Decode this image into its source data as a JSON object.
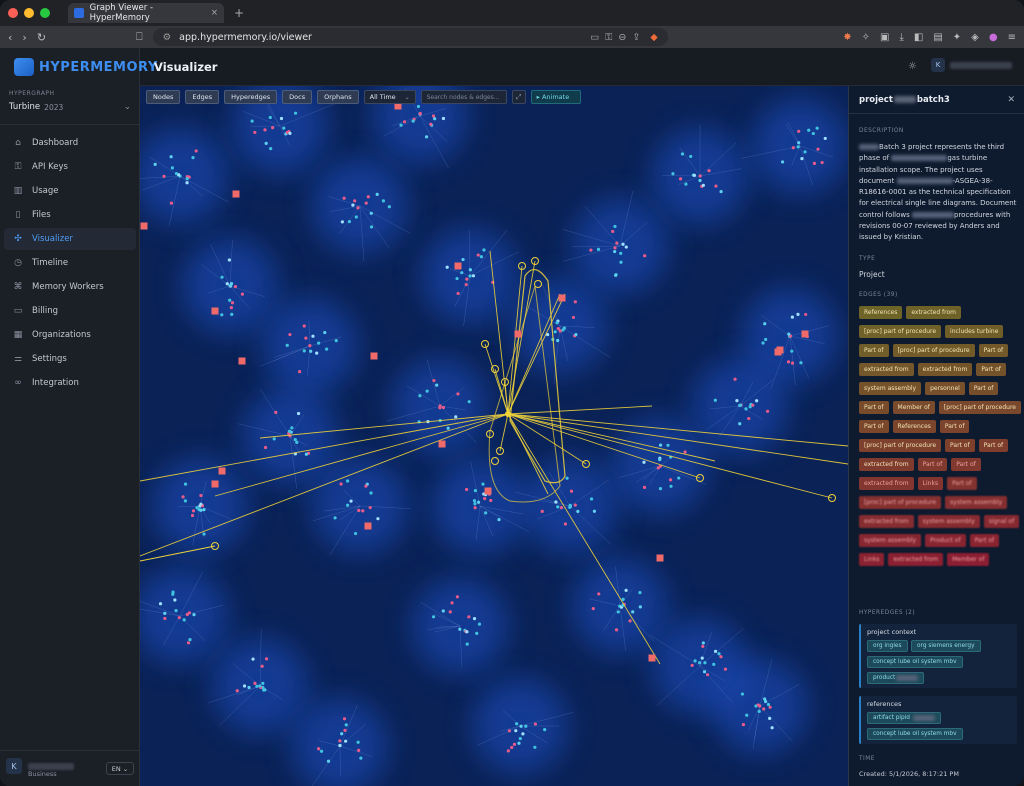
{
  "browser": {
    "tab_title": "Graph Viewer - HyperMemory",
    "url": "app.hypermemory.io/viewer"
  },
  "sidebar": {
    "logo": "HYPERMEMORY",
    "hypergraph_label": "HYPERGRAPH",
    "hypergraph_name": "Turbine",
    "hypergraph_year": "2023",
    "items": [
      {
        "label": "Dashboard",
        "icon": "home-icon"
      },
      {
        "label": "API Keys",
        "icon": "key-icon"
      },
      {
        "label": "Usage",
        "icon": "chart-icon"
      },
      {
        "label": "Files",
        "icon": "file-icon"
      },
      {
        "label": "Visualizer",
        "icon": "graph-icon",
        "active": true
      },
      {
        "label": "Timeline",
        "icon": "clock-icon"
      },
      {
        "label": "Memory Workers",
        "icon": "cpu-icon"
      },
      {
        "label": "Billing",
        "icon": "card-icon"
      },
      {
        "label": "Organizations",
        "icon": "building-icon"
      },
      {
        "label": "Settings",
        "icon": "sliders-icon"
      },
      {
        "label": "Integration",
        "icon": "link-icon"
      }
    ],
    "user_initial": "K",
    "user_plan": "Business",
    "language": "EN"
  },
  "header": {
    "title": "Visualizer",
    "user_initial": "K"
  },
  "toolbar": {
    "nodes": "Nodes",
    "edges": "Edges",
    "hyperedges": "Hyperedges",
    "docs": "Docs",
    "orphans": "Orphans",
    "time_filter": "All Time",
    "search_placeholder": "Search nodes & edges...",
    "animate": "▸ Animate"
  },
  "panel": {
    "title_a": "project",
    "title_b": "batch3",
    "description_label": "DESCRIPTION",
    "description": {
      "p1": "Batch 3 project represents the third phase of",
      "p2": "gas turbine installation scope. The project uses document",
      "p3": "-ASGEA-38-R18616-0001 as the technical specification for electrical single line diagrams. Document control follows",
      "p4": "procedures with revisions 00-07 reviewed by Anders and issued by Kristian."
    },
    "type_label": "TYPE",
    "type_value": "Project",
    "edges_label": "EDGES (39)",
    "edges": [
      "References",
      "extracted from",
      "[proc] part of procedure",
      "includes turbine",
      "Part of",
      "[proc] part of procedure",
      "Part of",
      "extracted from",
      "extracted from",
      "Part of",
      "system assembly",
      "personnel",
      "Part of",
      "Part of",
      "Member of",
      "[proc] part of procedure",
      "Part of",
      "References",
      "Part of",
      "[proc] part of procedure",
      "Part of",
      "Part of",
      "extracted from",
      "Part of",
      "Part of",
      "extracted from",
      "Links",
      "Part of",
      "[proc] part of procedure",
      "system assembly",
      "extracted from",
      "system assembly",
      "signal of",
      "system assembly",
      "Product of",
      "Part of",
      "Links",
      "extracted from",
      "Member of"
    ],
    "hyperedges_label": "HYPEREDGES (2)",
    "hyperedges": [
      {
        "name": "project context",
        "chips": [
          "org ingles",
          "org siemens energy",
          "concept lube oil system mbv",
          "product"
        ]
      },
      {
        "name": "references",
        "chips": [
          "artifact pipid",
          "concept lube oil system mbv"
        ]
      }
    ],
    "time_label": "TIME",
    "created": "Created: 5/1/2026, 8:17:21 PM"
  }
}
